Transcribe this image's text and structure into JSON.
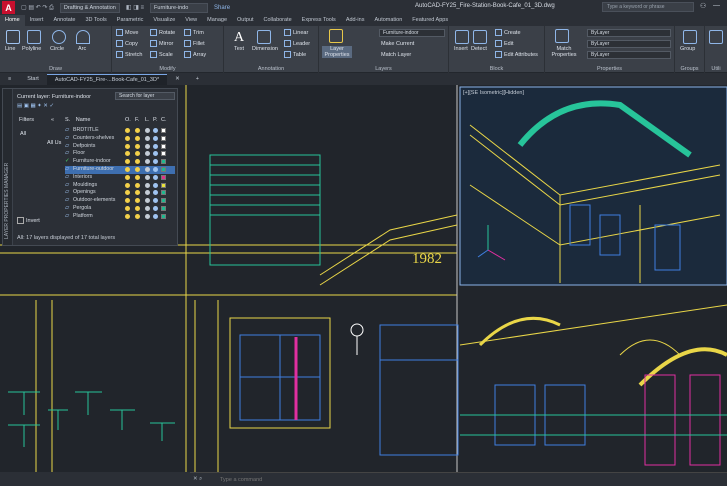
{
  "titlebar": {
    "logo": "A",
    "workspace": "Drafting & Annotation",
    "layer_combo": "Furniture-indo",
    "share": "Share",
    "doc_title": "AutoCAD-FY25_Fire-Station-Book-Cafe_01_3D.dwg",
    "search_placeholder": "Type a keyword or phrase"
  },
  "ribbon_tabs": [
    "Home",
    "Insert",
    "Annotate",
    "3D Tools",
    "Parametric",
    "Visualize",
    "View",
    "Manage",
    "Output",
    "Collaborate",
    "Express Tools",
    "Add-ins",
    "Automation",
    "Featured Apps"
  ],
  "ribbon": {
    "draw": {
      "title": "Draw",
      "tools": [
        "Line",
        "Polyline",
        "Circle",
        "Arc"
      ]
    },
    "modify": {
      "title": "Modify",
      "tools": [
        "Move",
        "Rotate",
        "Trim",
        "Copy",
        "Mirror",
        "Fillet",
        "Stretch",
        "Scale",
        "Array"
      ]
    },
    "annotation": {
      "title": "Annotation",
      "tools": [
        "Text",
        "Dimension",
        "Linear",
        "Leader",
        "Table"
      ]
    },
    "layers": {
      "title": "Layers",
      "big": "Layer Properties",
      "combo": "Furniture-indoor",
      "make_current": "Make Current",
      "match_layer": "Match Layer"
    },
    "block": {
      "title": "Block",
      "tools": [
        "Insert",
        "Detect",
        "Create",
        "Edit",
        "Edit Attributes"
      ]
    },
    "properties": {
      "title": "Properties",
      "match": "Match Properties",
      "bylayer1": "ByLayer",
      "bylayer2": "ByLayer",
      "bylayer3": "ByLayer"
    },
    "groups": {
      "title": "Groups",
      "tool": "Group"
    },
    "utilities": {
      "title": "Utili"
    }
  },
  "doc_tabs": {
    "start": "Start",
    "active": "AutoCAD-FY25_Fire-...Book-Cafe_01_3D*"
  },
  "layer_manager": {
    "current_layer": "Current layer: Furniture-indoor",
    "search": "Search for layer",
    "filters_label": "Filters",
    "tree_all": "All",
    "tree_all_used": "All Us",
    "invert_label": "Invert",
    "columns": [
      "S.",
      "Name",
      "O.",
      "F.",
      "L.",
      "P.",
      "C."
    ],
    "side_title": "LAYER PROPERTIES MANAGER",
    "status": "All: 17 layers displayed of 17 total layers",
    "rows": [
      {
        "name": "BRDTITLE",
        "color": "#ffffff"
      },
      {
        "name": "Counters-shelves",
        "color": "#ffffff"
      },
      {
        "name": "Defpoints",
        "color": "#ffffff"
      },
      {
        "name": "Floor",
        "color": "#ffffff"
      },
      {
        "name": "Furniture-indoor",
        "color": "#1fb88f"
      },
      {
        "name": "Furniture-outdoor",
        "color": "#1fb88f"
      },
      {
        "name": "Interiors",
        "color": "#e0318a"
      },
      {
        "name": "Mouldings",
        "color": "#e8e23a"
      },
      {
        "name": "Openings",
        "color": "#1fb88f"
      },
      {
        "name": "Outdoor-elements",
        "color": "#1fb88f"
      },
      {
        "name": "Pergola",
        "color": "#1fb88f"
      },
      {
        "name": "Platform",
        "color": "#1fb88f"
      }
    ]
  },
  "viewport_label": "[+][SE Isometric][Hidden]",
  "drawing_text": "1982",
  "command_placeholder": "Type a command",
  "colors": {
    "yellow": "#e9d648",
    "green": "#27c49a",
    "blue": "#3f7fe0",
    "magenta": "#e12fa0",
    "white": "#e6e6e6"
  }
}
